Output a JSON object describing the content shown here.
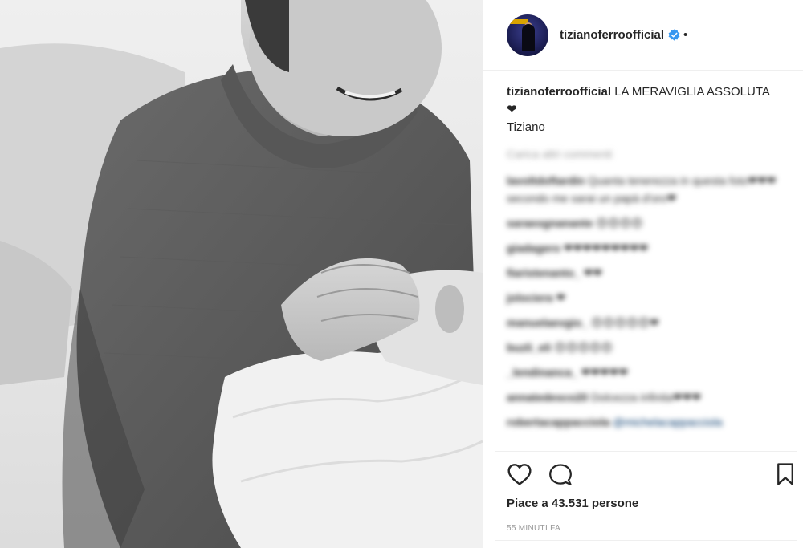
{
  "post": {
    "username": "tizianoferroofficial",
    "separator_dot": "•",
    "caption_user": "tizianoferroofficial",
    "caption_text": "LA MERAVIGLIA ASSOLUTA ❤",
    "caption_signature": "Tiziano",
    "load_more": "Carica altri commenti",
    "likes_label": "Piace a 43.531 persone",
    "time_label": "55 MINUTI FA"
  },
  "comments": [
    {
      "user": "lavoltdoftardin",
      "text": "Quanta tenerezza in questa foto❤❤❤ secondo me sarai un papà d'oro❤"
    },
    {
      "user": "saraeognanante",
      "text": "😍😍😍😍"
    },
    {
      "user": "giadagero",
      "text": "❤❤❤❤❤❤❤❤❤"
    },
    {
      "user": "fiaristenanto_",
      "text": "❤❤"
    },
    {
      "user": "jolociera",
      "text": "❤"
    },
    {
      "user": "manuelaevgio_",
      "text": "😍😍😍😍😍❤"
    },
    {
      "user": "buzli_eli",
      "text": "😍😍😍😍😍"
    },
    {
      "user": "_lendinanca_",
      "text": "❤❤❤❤❤"
    },
    {
      "user": "annatedesco20",
      "text": "Dolcezza infinita❤❤❤"
    },
    {
      "user": "robertacappacciola",
      "text": "",
      "tag": "@michelacappacciola"
    }
  ],
  "icons": {
    "like": "heart-outline-icon",
    "comment": "comment-bubble-icon",
    "save": "bookmark-outline-icon",
    "verified": "verified-badge-icon"
  },
  "colors": {
    "verified_blue": "#3897f0",
    "text_primary": "#262626",
    "text_secondary": "#999999",
    "divider": "#efefef"
  }
}
